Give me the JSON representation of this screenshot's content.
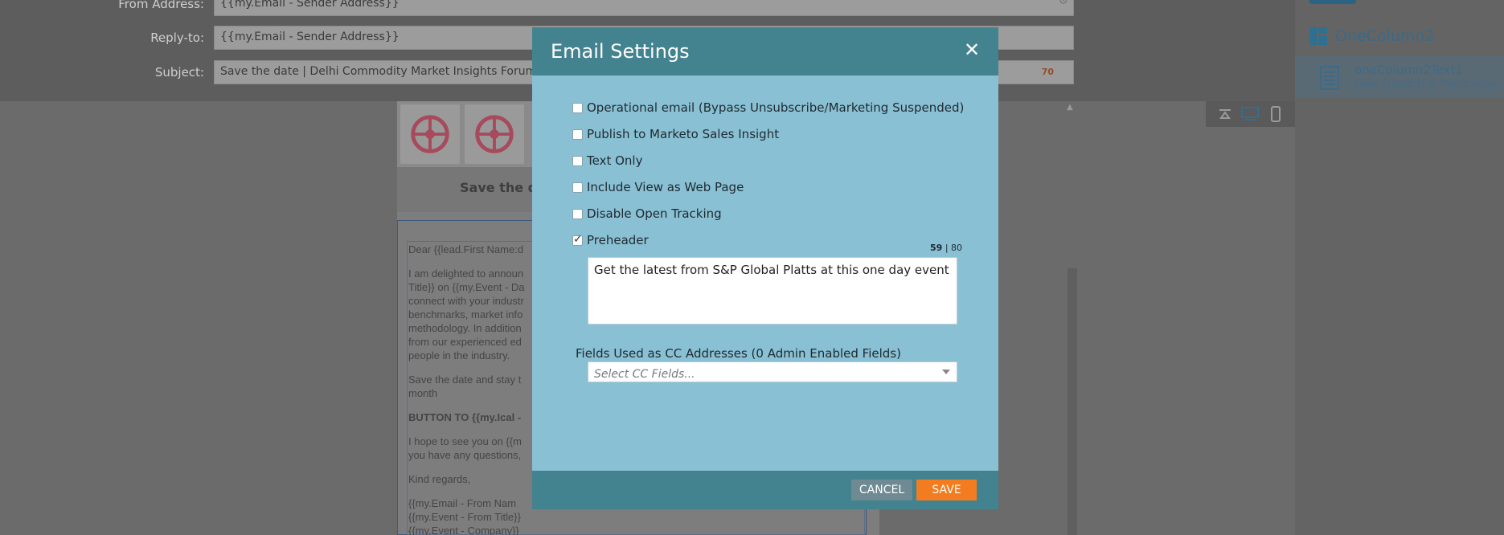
{
  "editor": {
    "fields": [
      {
        "label": "From Address:",
        "value": "{{my.Email - Sender Address}}"
      },
      {
        "label": "Reply-to:",
        "value": "{{my.Email - Sender Address}}"
      },
      {
        "label": "Subject:",
        "value": "Save the date | Delhi Commodity Market Insights Forum on",
        "count": "70"
      }
    ],
    "preview": {
      "save_title": "Save the da",
      "paragraphs": [
        "Dear {{lead.First Name:d",
        "I am delighted to announ\nTitle}} on {{my.Event - Da\nconnect with your industr\nbenchmarks, market info\nmethodology. In addition\nfrom our experienced ed\npeople in the industry.",
        "Save the date and stay t\nmonth",
        "BUTTON TO {{my.Ical -",
        "I hope to see you on {{m\nyou have any questions,",
        "Kind regards,",
        "{{my.Email - From Nam\n{{my.Event - From Title}}\n{{my.Event - Company}}"
      ]
    }
  },
  "right_panel": {
    "module_label": "OneColumn2",
    "item_title": "oneColumn2Text1",
    "item_subtitle": "Dear {{lead.First Name:defau..."
  },
  "modal": {
    "title": "Email Settings",
    "options": [
      {
        "label": "Operational email (Bypass Unsubscribe/Marketing Suspended)",
        "checked": false
      },
      {
        "label": "Publish to Marketo Sales Insight",
        "checked": false
      },
      {
        "label": "Text Only",
        "checked": false
      },
      {
        "label": "Include View as Web Page",
        "checked": false
      },
      {
        "label": "Disable Open Tracking",
        "checked": false
      },
      {
        "label": "Preheader",
        "checked": true
      }
    ],
    "preheader": {
      "count": "59",
      "separator": "|",
      "max": "80",
      "value": "Get the latest from S&P Global Platts at this one day event"
    },
    "cc": {
      "label": "Fields Used as CC Addresses (0 Admin Enabled Fields)",
      "placeholder": "Select CC Fields..."
    },
    "buttons": {
      "cancel": "CANCEL",
      "save": "SAVE"
    }
  },
  "colors": {
    "modal_bg": "#89c0d3",
    "modal_header": "#43838f",
    "save_button": "#f27c1f",
    "cancel_button": "#6f8a93"
  },
  "icons": {
    "close": "close-icon",
    "module": "layout-column-icon",
    "item": "text-document-icon",
    "view_desktop": "desktop-icon",
    "view_mobile": "mobile-icon",
    "view_collapse": "collapse-top-icon"
  }
}
